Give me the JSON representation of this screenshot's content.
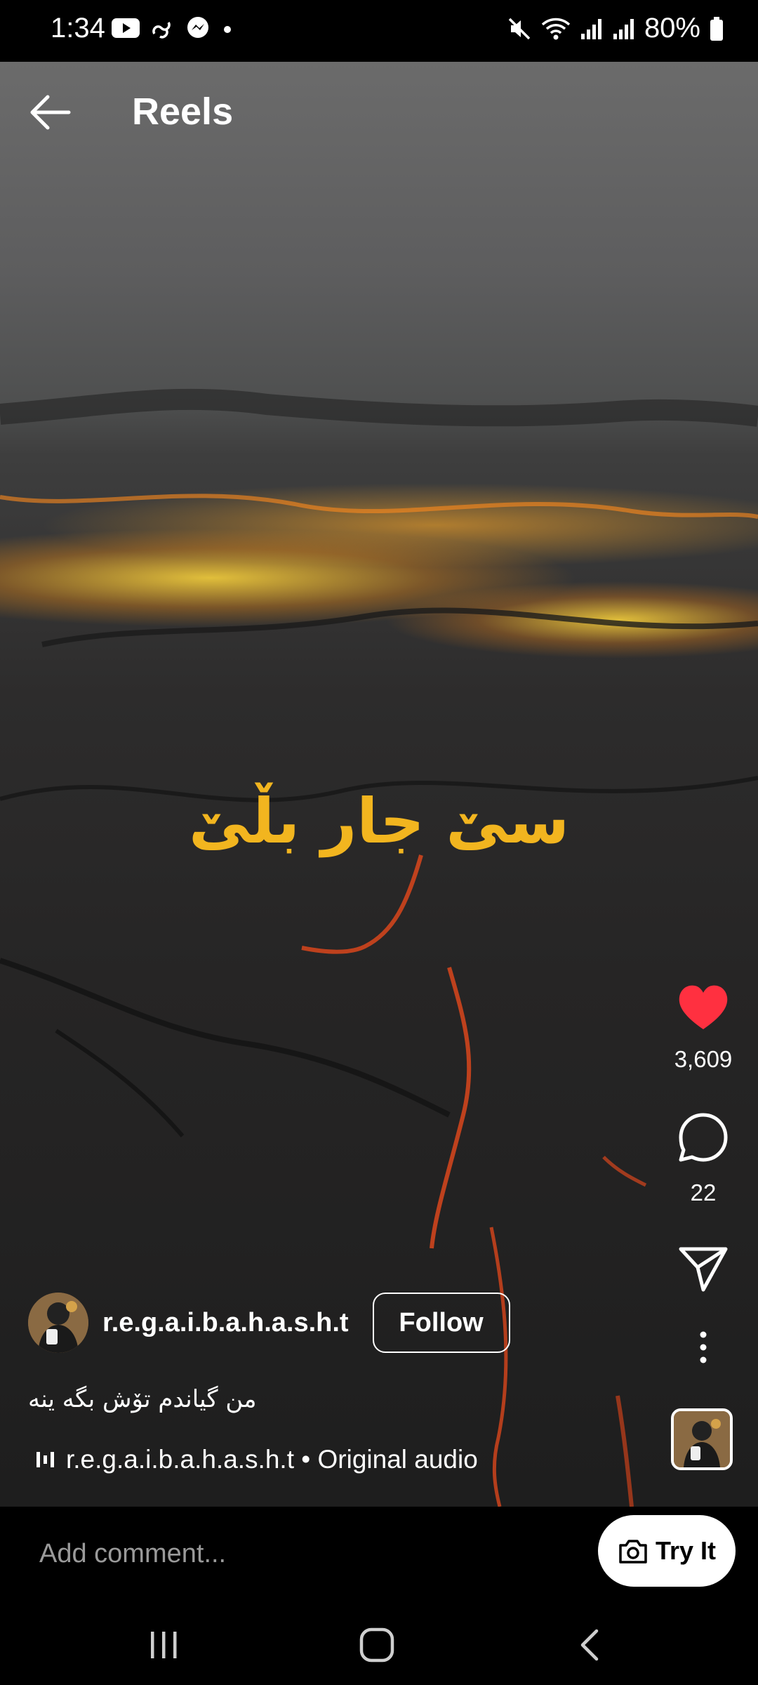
{
  "status_bar": {
    "time": "1:34",
    "battery": "80%",
    "left_icons": [
      "youtube-icon",
      "link-icon",
      "messenger-icon",
      "dot-icon"
    ],
    "right_icons": [
      "mute-icon",
      "wifi-icon",
      "signal-icon",
      "signal-icon",
      "battery-icon"
    ]
  },
  "header": {
    "title": "Reels"
  },
  "video": {
    "overlay_text": "سێ جار بڵێ",
    "colors": {
      "overlay_text": "#f2b51f",
      "lava": "#ff9a1e"
    }
  },
  "actions": {
    "likes": "3,609",
    "comments": "22",
    "like_color": "#ff3040"
  },
  "author": {
    "username": "r.e.g.a.i.b.a.h.a.s.h.t",
    "follow_label": "Follow"
  },
  "caption": "من گیاندم تۆش بگە ینە",
  "audio": {
    "text": "r.e.g.a.i.b.a.h.a.s.h.t • Original audio"
  },
  "comment": {
    "placeholder": "Add comment...",
    "try_label": "Try It"
  },
  "nav": {
    "items": [
      "recents-icon",
      "home-icon",
      "back-icon"
    ]
  }
}
